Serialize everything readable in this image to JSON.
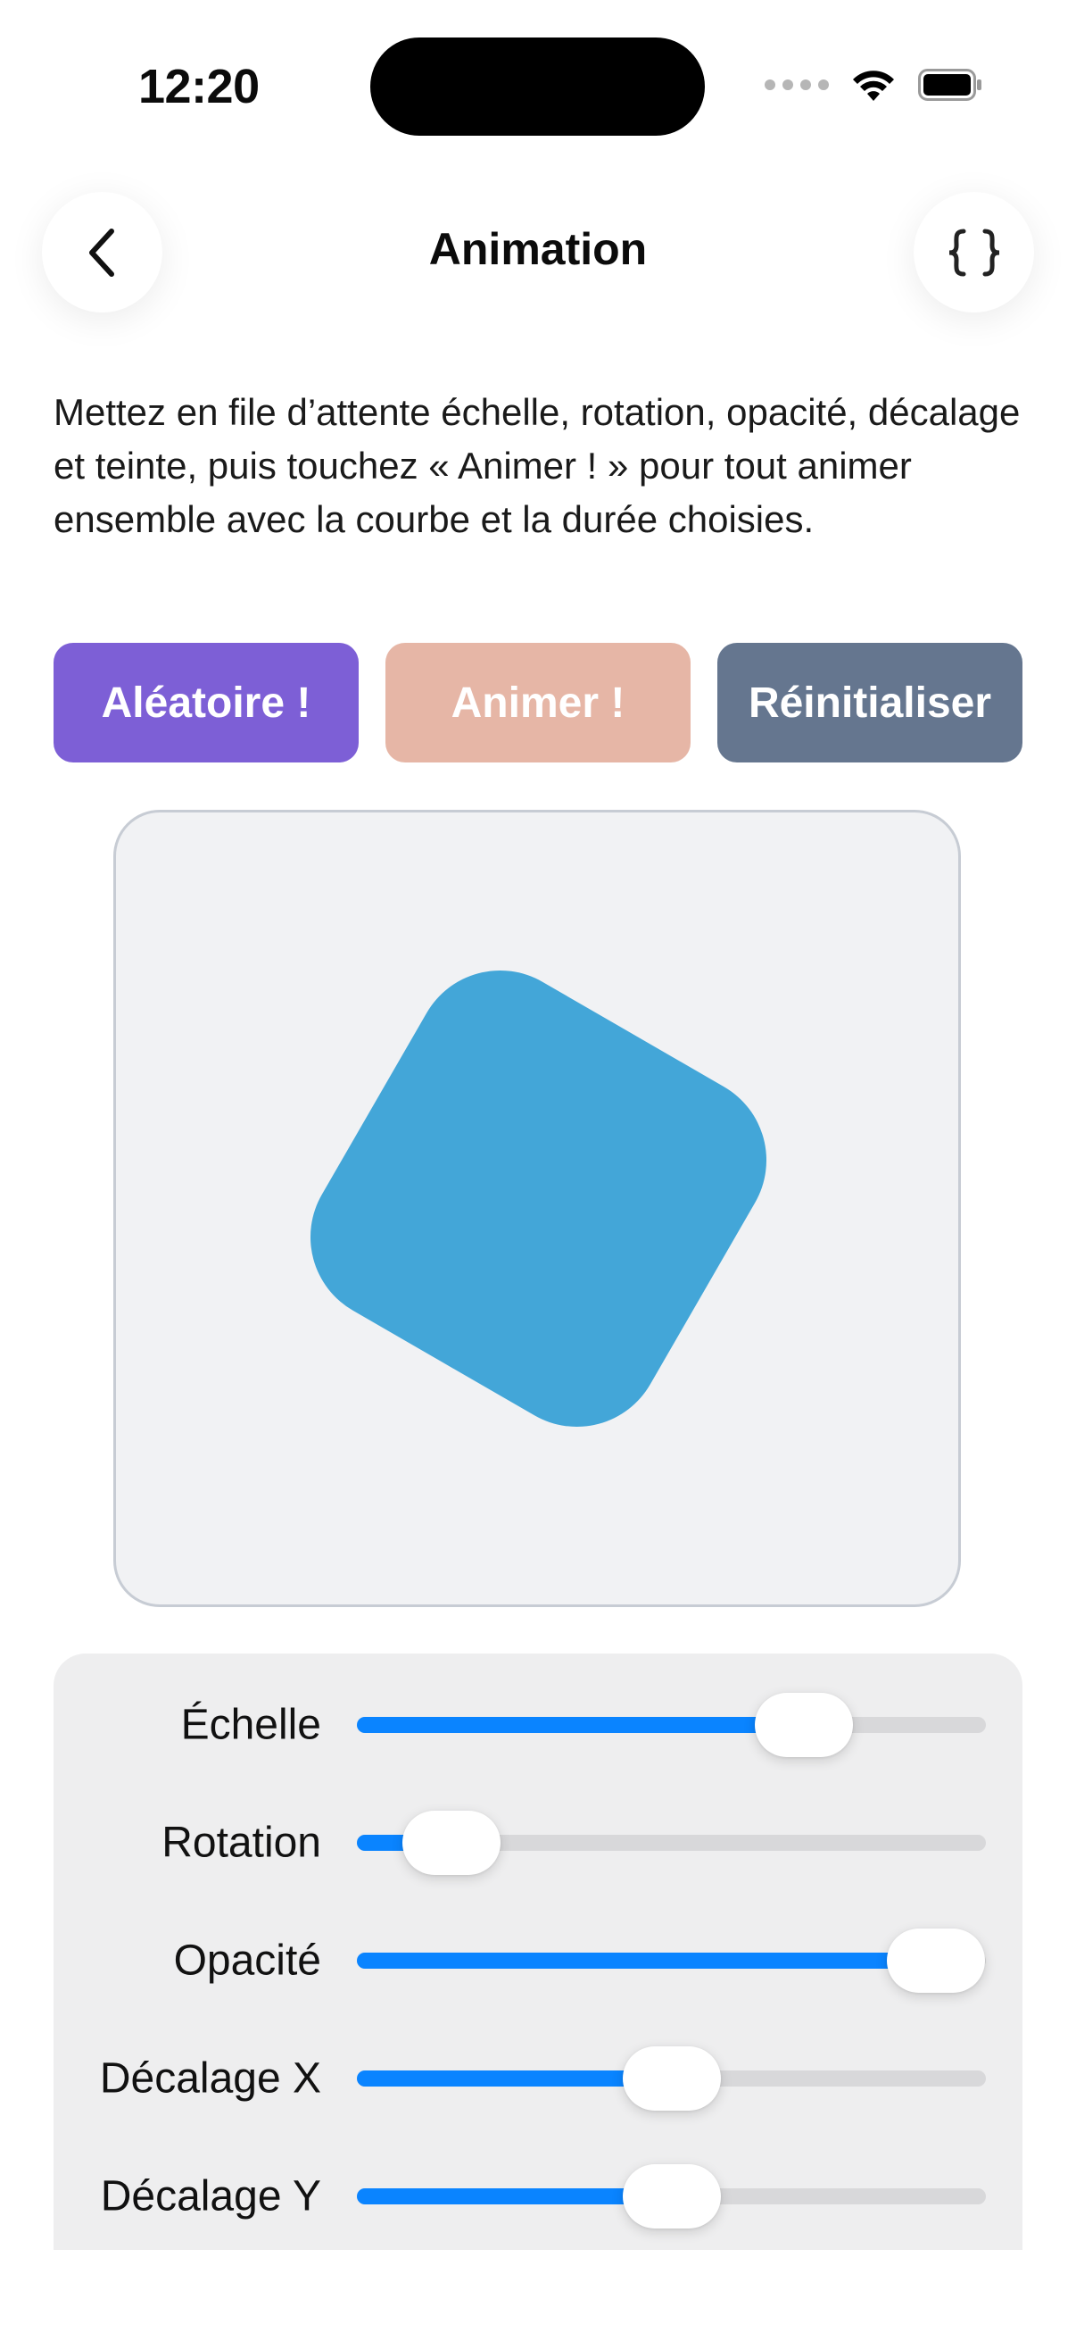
{
  "status_bar": {
    "time": "12:20"
  },
  "nav": {
    "title": "Animation",
    "back_icon": "chevron-left-icon",
    "code_icon": "curly-braces-icon"
  },
  "description": "Mettez en file d’attente échelle, rotation, opacité, décalage et teinte, puis touchez « Animer ! » pour tout animer ensemble avec la courbe et la durée choisies.",
  "buttons": {
    "random": "Aléatoire !",
    "animate": "Animer !",
    "reset": "Réinitialiser"
  },
  "colors": {
    "random_button": "#7d5fd6",
    "animate_button": "#e6b6a6",
    "reset_button": "#65768f",
    "shape": "#43a6d8",
    "slider_accent": "#0a84ff"
  },
  "preview": {
    "rotation_deg": 30
  },
  "sliders": [
    {
      "label": "Échelle",
      "value": 0.71
    },
    {
      "label": "Rotation",
      "value": 0.15
    },
    {
      "label": "Opacité",
      "value": 0.92
    },
    {
      "label": "Décalage X",
      "value": 0.5
    },
    {
      "label": "Décalage Y",
      "value": 0.5
    }
  ]
}
